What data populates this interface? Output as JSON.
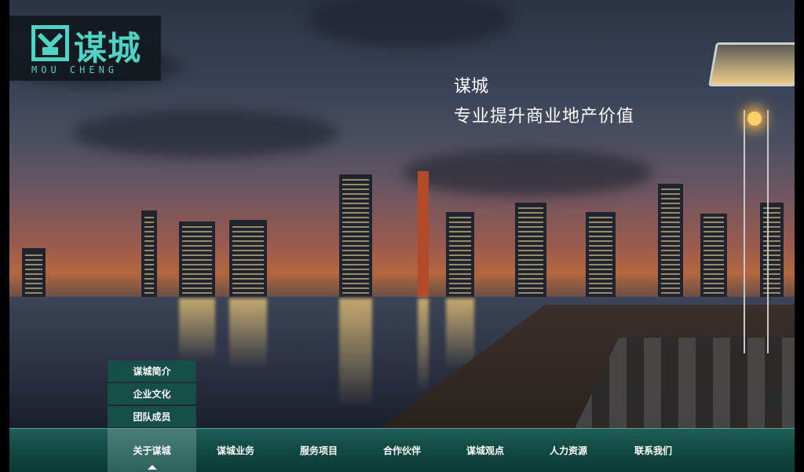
{
  "logo": {
    "cn": "谋城",
    "en": "MOU CHENG",
    "color": "#4fd3c4"
  },
  "hero": {
    "line1": "谋城",
    "line2": "专业提升商业地产价值"
  },
  "submenu": {
    "items": [
      {
        "label": "谋城简介"
      },
      {
        "label": "企业文化"
      },
      {
        "label": "团队成员"
      }
    ]
  },
  "nav": {
    "items": [
      {
        "label": "关于谋城",
        "active": true
      },
      {
        "label": "谋城业务"
      },
      {
        "label": "服务项目"
      },
      {
        "label": "合作伙伴"
      },
      {
        "label": "谋城观点"
      },
      {
        "label": "人力资源"
      },
      {
        "label": "联系我们"
      }
    ]
  },
  "colors": {
    "nav_bg": "#134a44",
    "submenu_bg": "#174e48",
    "accent": "#4fd3c4"
  }
}
